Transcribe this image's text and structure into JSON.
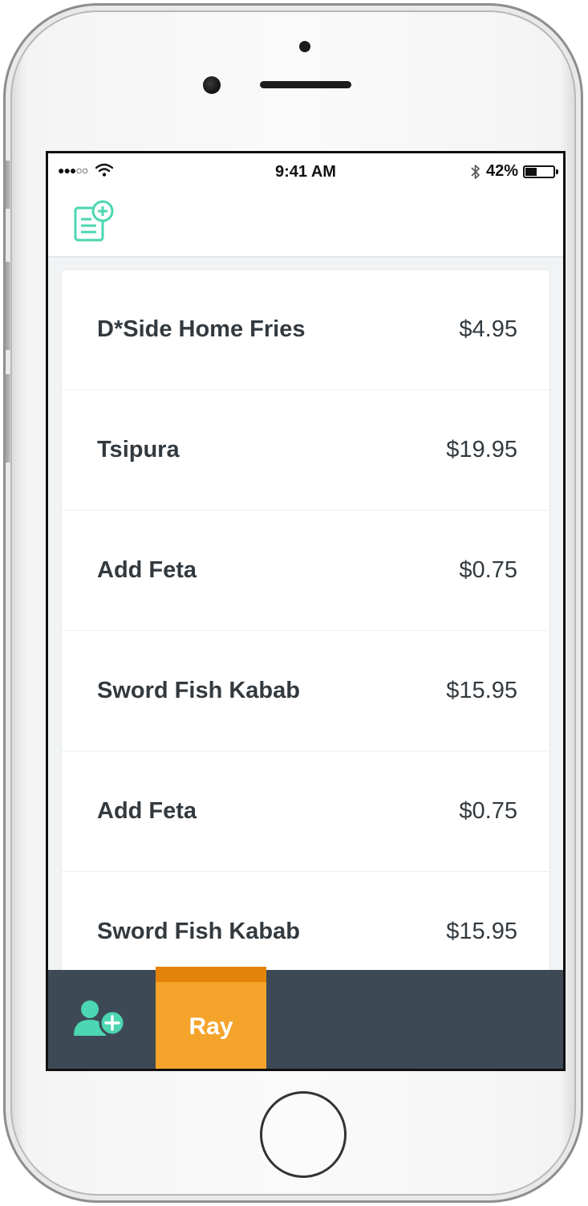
{
  "status_bar": {
    "signal": "●●●○○",
    "time": "9:41 AM",
    "battery_percent_text": "42%",
    "battery_level": 0.42
  },
  "nav": {
    "new_order_icon": "document-plus-icon"
  },
  "order_items": [
    {
      "name": "D*Side Home Fries",
      "price": "$4.95"
    },
    {
      "name": "Tsipura",
      "price": "$19.95"
    },
    {
      "name": "Add Feta",
      "price": "$0.75"
    },
    {
      "name": "Sword Fish Kabab",
      "price": "$15.95"
    },
    {
      "name": "Add Feta",
      "price": "$0.75"
    },
    {
      "name": "Sword Fish Kabab",
      "price": "$15.95"
    }
  ],
  "bottom_bar": {
    "add_person_icon": "user-plus-icon",
    "tabs": [
      {
        "label": "Ray"
      }
    ]
  },
  "colors": {
    "accent_teal": "#4cd6b1",
    "tab_orange": "#f4a42a",
    "tab_orange_dark": "#e3830a",
    "bottom_bar": "#3d4a56",
    "text": "#333a3f"
  }
}
